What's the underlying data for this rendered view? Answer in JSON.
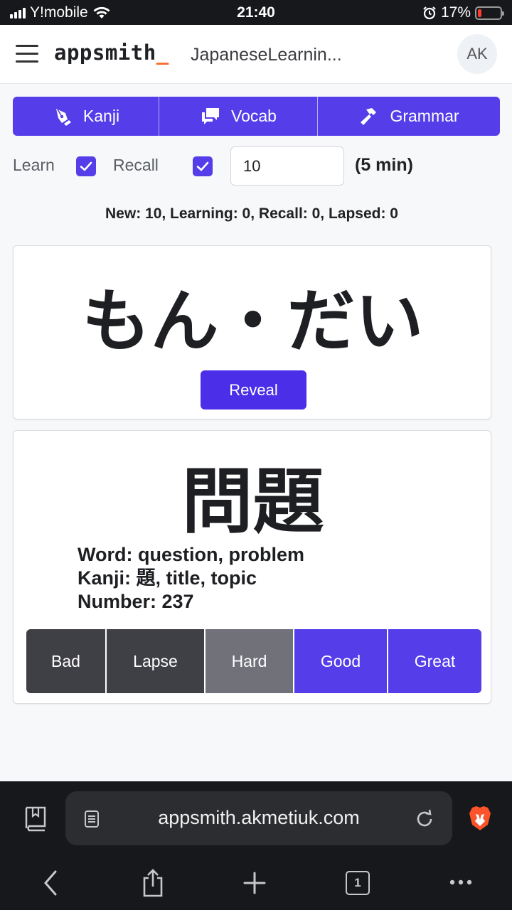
{
  "status_bar": {
    "carrier": "Y!mobile",
    "time": "21:40",
    "battery_percent": "17%",
    "battery_level": 0.17
  },
  "header": {
    "logo": "appsmith",
    "logo_cursor": "_",
    "app_title": "JapaneseLearnin...",
    "avatar_initials": "AK"
  },
  "tabs": [
    {
      "label": "Kanji",
      "icon": "brush-icon"
    },
    {
      "label": "Vocab",
      "icon": "chat-icon"
    },
    {
      "label": "Grammar",
      "icon": "hammer-icon"
    }
  ],
  "controls": {
    "learn_label": "Learn",
    "learn_checked": true,
    "recall_label": "Recall",
    "recall_checked": true,
    "count_value": "10",
    "duration_label": "(5 min)"
  },
  "stats_text": "New: 10, Learning: 0, Recall: 0, Lapsed: 0",
  "flashcard": {
    "reading": "もん・だい",
    "reveal_label": "Reveal"
  },
  "answer": {
    "kanji": "問題",
    "word_line": "Word: question, problem",
    "kanji_line": "Kanji: 題, title, topic",
    "number_line": "Number: 237"
  },
  "ratings": [
    {
      "label": "Bad",
      "color": "#3f3f46"
    },
    {
      "label": "Lapse",
      "color": "#3f3f46"
    },
    {
      "label": "Hard",
      "color": "#71717a"
    },
    {
      "label": "Good",
      "color": "#553de9"
    },
    {
      "label": "Great",
      "color": "#553de9"
    }
  ],
  "browser": {
    "url": "appsmith.akmetiuk.com",
    "tab_count": "1"
  },
  "colors": {
    "accent": "#553de9",
    "dark_button": "#3f3f46",
    "grey_button": "#71717a",
    "status_bar": "#17181b"
  }
}
